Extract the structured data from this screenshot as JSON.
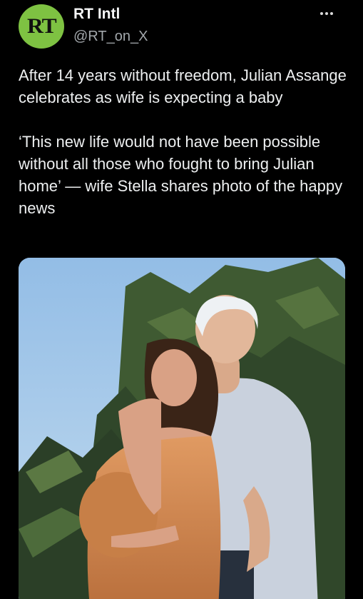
{
  "account": {
    "avatar_text": "RT",
    "display_name": "RT Intl",
    "handle": "@RT_on_X"
  },
  "tweet": {
    "text": "After 14 years without freedom, Julian Assange celebrates as wife is expecting a baby\n\n‘This new life would not have been possible without all those who fought to bring Julian home’ — wife Stella shares photo of the happy news"
  },
  "media": {
    "description_icon": "photo-icon"
  },
  "colors": {
    "background": "#000000",
    "avatar_green": "#7ec242",
    "secondary_text": "#a2a7ab"
  }
}
